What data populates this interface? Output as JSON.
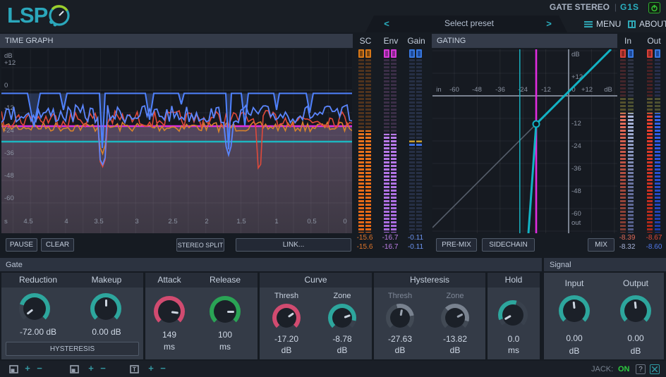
{
  "colors": {
    "accent_teal": "#2bb0c0",
    "magenta": "#e02ce0",
    "logo_green": "#9ccf2a",
    "knob_teal": "#2da69d",
    "knob_pink": "#d14b70",
    "knob_green": "#2aa455",
    "meter_sc": "#e8731c",
    "meter_env": "#b97ae9",
    "meter_gain": "#3a6fe0",
    "meter_red": "#e04835",
    "meter_blue": "#3566ee",
    "jack_on_green": "#2ecc40"
  },
  "topbar": {
    "logo_text": "LSP",
    "plugin_title": "GATE STEREO",
    "separator": "|",
    "plugin_id": "G1S"
  },
  "presetbar": {
    "chevron_left": "<",
    "preset_label": "Select preset",
    "chevron_right": ">",
    "menu_label": "MENU",
    "about_label": "ABOUT"
  },
  "time_graph": {
    "title": "TIME GRAPH",
    "db_axis_labels": [
      "dB",
      "+12",
      "0",
      "-12",
      "-24",
      "-36",
      "-48",
      "-60"
    ],
    "time_axis_labels": [
      "s",
      "4.5",
      "4",
      "3.5",
      "3",
      "2.5",
      "2",
      "1.5",
      "1",
      "0.5",
      "0"
    ],
    "pause_button": "PAUSE",
    "clear_button": "CLEAR",
    "stereo_split_button": "STEREO SPLIT",
    "link_button": "LINK..."
  },
  "meters": {
    "sc": {
      "label": "SC",
      "value_left": "-15.6",
      "value_right": "-15.6"
    },
    "env": {
      "label": "Env",
      "value_left": "-16.7",
      "value_right": "-16.7"
    },
    "gain": {
      "label": "Gain",
      "value_left": "-0.11",
      "value_right": "-0.11"
    },
    "input": {
      "label": "In",
      "value_left": "-8.39",
      "value_right": "-8.32"
    },
    "output": {
      "label": "Out",
      "value_left": "-8.67",
      "value_right": "-8.60"
    }
  },
  "gating": {
    "title": "GATING",
    "x_axis_labels": [
      "in",
      "-60",
      "-48",
      "-36",
      "-24",
      "-12",
      "0",
      "+12",
      "dB"
    ],
    "y_axis_labels": [
      "dB",
      "+12",
      "-12",
      "-24",
      "-36",
      "-48",
      "-60",
      "out"
    ],
    "premix_button": "PRE-MIX",
    "sidechain_button": "SIDECHAIN",
    "mix_button": "MIX"
  },
  "gate": {
    "title": "Gate",
    "reduction": {
      "label": "Reduction",
      "value": "-72.00 dB"
    },
    "makeup": {
      "label": "Makeup",
      "value": "0.00 dB"
    },
    "hysteresis_button": "HYSTERESIS",
    "attack": {
      "label": "Attack",
      "value": "149",
      "unit": "ms"
    },
    "release": {
      "label": "Release",
      "value": "100",
      "unit": "ms"
    },
    "curve": {
      "title": "Curve",
      "thresh": {
        "label": "Thresh",
        "value": "-17.20",
        "unit": "dB"
      },
      "zone": {
        "label": "Zone",
        "value": "-8.78",
        "unit": "dB"
      }
    },
    "hysteresis": {
      "title": "Hysteresis",
      "thresh": {
        "label": "Thresh",
        "value": "-27.63",
        "unit": "dB"
      },
      "zone": {
        "label": "Zone",
        "value": "-13.82",
        "unit": "dB"
      }
    },
    "hold": {
      "title": "Hold",
      "value": "0.0",
      "unit": "ms"
    }
  },
  "signal": {
    "title": "Signal",
    "input": {
      "label": "Input",
      "value": "0.00",
      "unit": "dB"
    },
    "output": {
      "label": "Output",
      "value": "0.00",
      "unit": "dB"
    }
  },
  "statusbar": {
    "plus": "+",
    "minus": "−",
    "jack_label": "JACK:",
    "jack_status": "ON",
    "help_icon": "?"
  }
}
